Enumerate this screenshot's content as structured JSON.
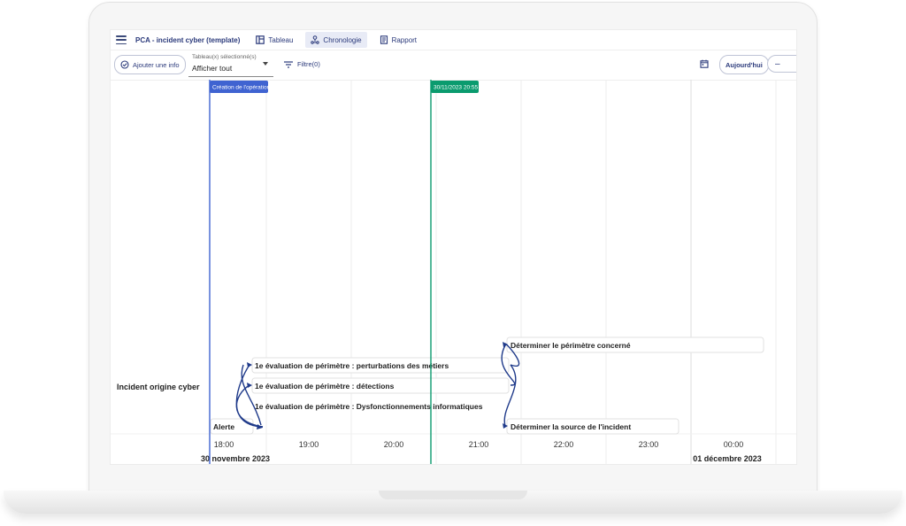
{
  "app": {
    "title": "PCA - incident cyber (template)",
    "tabs": [
      {
        "label": "Tableau",
        "icon": "table-icon",
        "active": false
      },
      {
        "label": "Chronologie",
        "icon": "timeline-icon",
        "active": true
      },
      {
        "label": "Rapport",
        "icon": "report-icon",
        "active": false
      }
    ]
  },
  "toolbar": {
    "add_label": "Ajouter une info",
    "select_label": "Tableau(x) sélectionné(s)",
    "select_value": "Afficher tout",
    "filter_label": "Filtre(0)",
    "today_label": "Aujourd'hui",
    "zoom_out_label": "–"
  },
  "timeline": {
    "row_label": "Incident origine cyber",
    "operation_marker": {
      "label": "Création de l'opération",
      "color": "#3f63d1"
    },
    "current_marker": {
      "label": "30/11/2023 20:55",
      "color": "#0a9b6e"
    },
    "hours": [
      "18:00",
      "19:00",
      "20:00",
      "21:00",
      "22:00",
      "23:00",
      "00:00"
    ],
    "dates": [
      {
        "label": "30 novembre 2023"
      },
      {
        "label": "01 décembre 2023"
      }
    ],
    "events": [
      {
        "label": "Déterminer le périmètre concerné"
      },
      {
        "label": "1e évaluation de périmètre : perturbations des métiers"
      },
      {
        "label": "1e évaluation de périmètre : détections"
      },
      {
        "label": "1e évaluation de périmètre : Dysfonctionnements informatiques"
      },
      {
        "label": "Alerte"
      },
      {
        "label": "Déterminer la source de l'incident"
      }
    ],
    "dependency_color": "#1f3a8a"
  }
}
